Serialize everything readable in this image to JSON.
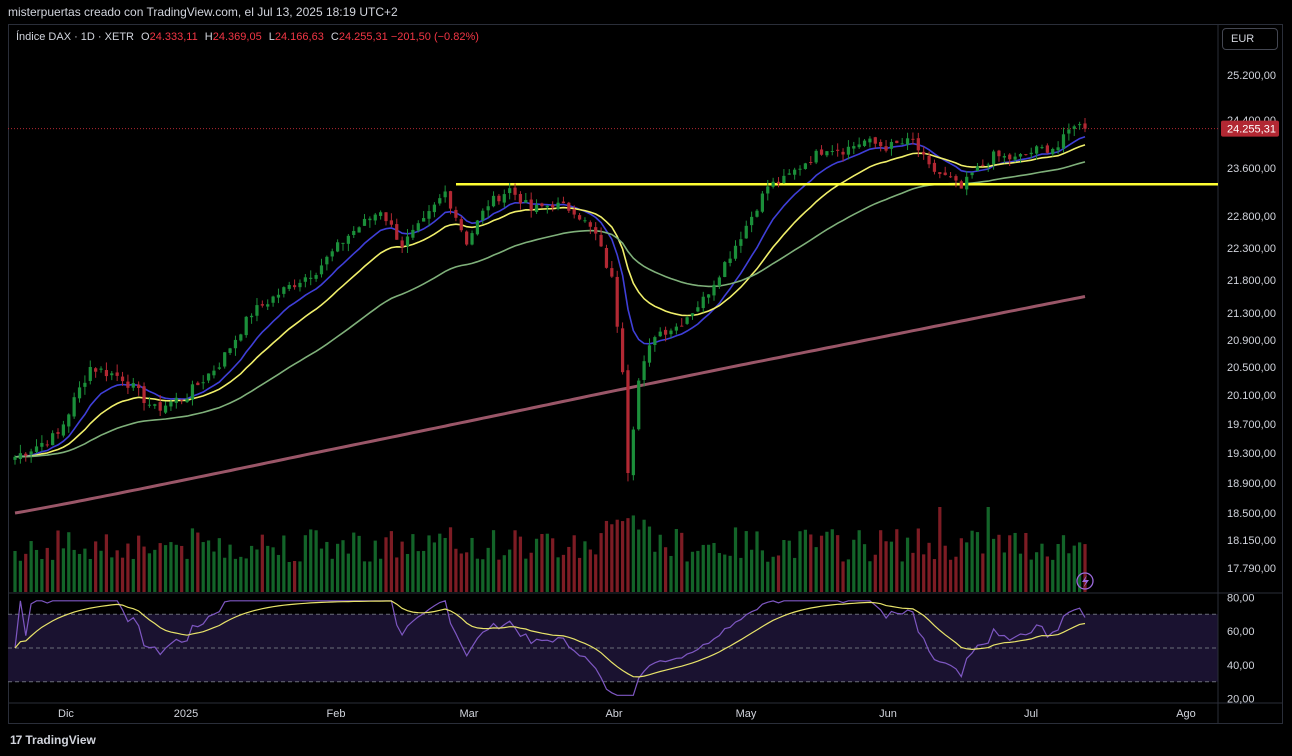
{
  "header": {
    "attribution": "misterpuertas creado con TradingView.com, el Jul 13, 2025 18:19 UTC+2"
  },
  "legend": {
    "symbol": "Índice DAX · 1D · XETR",
    "o_label": "O",
    "o_value": "24.333,11",
    "h_label": "H",
    "h_value": "24.369,05",
    "l_label": "L",
    "l_value": "24.166,63",
    "c_label": "C",
    "c_value": "24.255,31",
    "change": "−201,50 (−0.82%)"
  },
  "currency": "EUR",
  "footer": {
    "logo": "17",
    "brand": "TradingView"
  },
  "colors": {
    "up": "#1b8f3a",
    "down": "#b22833",
    "ema_fast": "#3f3fd8",
    "ema_mid": "#f0ef6a",
    "ema_slow": "#7fb07a",
    "ema_200": "#b5657a",
    "support": "#ffff33",
    "rsi": "#7e57c2",
    "rsi_ma": "#e8e36a",
    "price_tag": "#b22833"
  },
  "chart_data": [
    {
      "type": "candlestick",
      "title": "Índice DAX · 1D · XETR",
      "x_ticks": [
        "Dic",
        "2025",
        "Feb",
        "Mar",
        "Abr",
        "May",
        "Jun",
        "Jul",
        "Ago"
      ],
      "y_ticks": [
        "25.200,00",
        "24.400,00",
        "23.600,00",
        "22.800,00",
        "22.300,00",
        "21.800,00",
        "21.300,00",
        "20.900,00",
        "20.500,00",
        "20.100,00",
        "19.700,00",
        "19.300,00",
        "18.900,00",
        "18.500,00",
        "18.150,00",
        "17.790,00"
      ],
      "y_tick_values": [
        25200,
        24400,
        23600,
        22800,
        22300,
        21800,
        21300,
        20900,
        20500,
        20100,
        19700,
        19300,
        18900,
        18500,
        18150,
        17790
      ],
      "last_price": 24255.31,
      "last_price_label": "24.255,31",
      "support_level": 23330,
      "price_anchors": [
        [
          0,
          19250
        ],
        [
          8,
          19550
        ],
        [
          14,
          20500
        ],
        [
          20,
          20350
        ],
        [
          26,
          19900
        ],
        [
          32,
          20100
        ],
        [
          38,
          20550
        ],
        [
          44,
          21300
        ],
        [
          50,
          21650
        ],
        [
          56,
          21950
        ],
        [
          62,
          22500
        ],
        [
          68,
          22900
        ],
        [
          72,
          22350
        ],
        [
          76,
          22700
        ],
        [
          80,
          23200
        ],
        [
          84,
          22400
        ],
        [
          88,
          23000
        ],
        [
          92,
          23250
        ],
        [
          96,
          22900
        ],
        [
          100,
          23000
        ],
        [
          104,
          22900
        ],
        [
          108,
          22500
        ],
        [
          111,
          21800
        ],
        [
          113,
          20500
        ],
        [
          114,
          19100
        ],
        [
          116,
          20300
        ],
        [
          119,
          21000
        ],
        [
          123,
          21100
        ],
        [
          128,
          21500
        ],
        [
          133,
          22200
        ],
        [
          137,
          22800
        ],
        [
          140,
          23300
        ],
        [
          143,
          23400
        ],
        [
          147,
          23700
        ],
        [
          151,
          23950
        ],
        [
          154,
          23900
        ],
        [
          158,
          24050
        ],
        [
          162,
          23950
        ],
        [
          167,
          24050
        ],
        [
          170,
          23600
        ],
        [
          174,
          23400
        ],
        [
          176,
          23250
        ],
        [
          178,
          23500
        ],
        [
          182,
          23800
        ],
        [
          186,
          23750
        ],
        [
          190,
          23900
        ],
        [
          194,
          23950
        ],
        [
          197,
          24350
        ],
        [
          199,
          24255
        ]
      ],
      "emas": [
        {
          "period": 10,
          "color": "#3f3fd8"
        },
        {
          "period": 20,
          "color": "#f0ef6a"
        },
        {
          "period": 50,
          "color": "#7fb07a"
        },
        {
          "period": 200,
          "color": "#b5657a"
        }
      ]
    },
    {
      "type": "line",
      "title": "",
      "y_ticks": [
        "80,00",
        "60,00",
        "40,00",
        "20,00"
      ],
      "y_tick_values": [
        80,
        60,
        40,
        20
      ],
      "bands": [
        70,
        50,
        30
      ],
      "ylim": [
        18,
        82
      ]
    }
  ]
}
